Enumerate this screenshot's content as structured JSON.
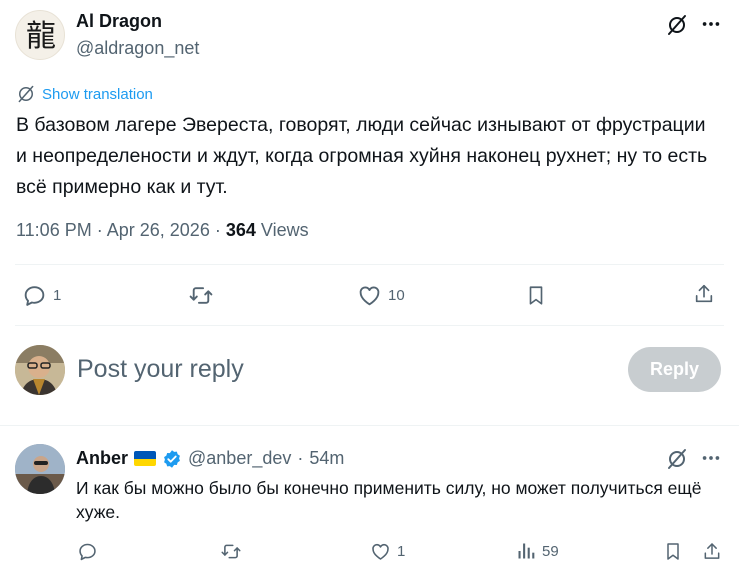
{
  "post": {
    "author_name": "Al Dragon",
    "author_handle": "@aldragon_net",
    "avatar_glyph": "龍",
    "translate_label": "Show translation",
    "text": "В базовом лагере Эвереста, говорят, люди сейчас изнывают от фрустрации и неопределености и ждут, когда огромная хуйня наконец рухнет; ну то есть всё примерно как и тут.",
    "time": "11:06 PM",
    "date": "Apr 26, 2026",
    "views_count": "364",
    "views_label": "Views",
    "replies": "1",
    "likes": "10"
  },
  "composer": {
    "placeholder": "Post your reply",
    "button_label": "Reply"
  },
  "reply": {
    "author_name": "Anber",
    "author_handle": "@anber_dev",
    "time_ago": "54m",
    "text": "И как бы можно было бы конечно применить силу, но может получиться ещё хуже.",
    "likes": "1",
    "views": "59"
  },
  "colors": {
    "accent": "#1d9bf0",
    "muted_text": "#536471",
    "reply_button_disabled": "#c8cdd0",
    "flag_blue": "#0057b7",
    "flag_yellow": "#ffd700"
  },
  "icons": [
    "grok-icon",
    "more-icon",
    "translate-icon",
    "reply-icon",
    "retweet-icon",
    "like-icon",
    "bookmark-icon",
    "share-icon",
    "verified-icon",
    "views-icon"
  ]
}
